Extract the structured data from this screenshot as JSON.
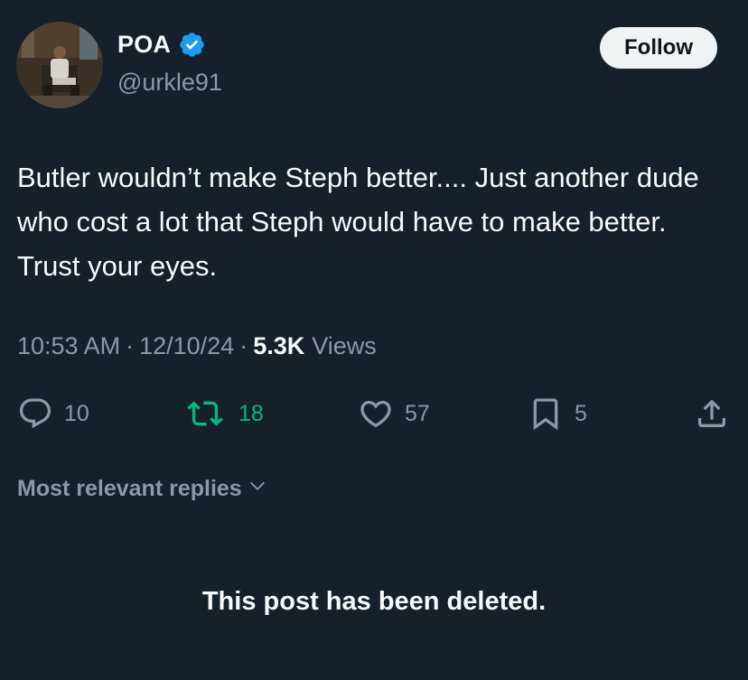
{
  "author": {
    "name": "POA",
    "handle": "@urkle91",
    "verified": true,
    "verified_color": "#1d9bf0"
  },
  "follow_label": "Follow",
  "tweet": {
    "text": "Butler wouldn’t make Steph better.... Just another dude who cost a lot that Steph would have to make better. Trust your eyes.",
    "time": "10:53 AM",
    "date": "12/10/24",
    "views_count": "5.3K",
    "views_label": "Views"
  },
  "actions": {
    "replies": "10",
    "retweets": "18",
    "likes": "57",
    "bookmarks": "5"
  },
  "replies_filter_label": "Most relevant replies",
  "deleted_message": "This post has been deleted.",
  "colors": {
    "background": "#15202b",
    "muted": "#8b98a5",
    "retweet": "#00ba7c"
  },
  "icons": [
    "avatar",
    "verified-badge-icon",
    "reply-icon",
    "retweet-icon",
    "like-icon",
    "bookmark-icon",
    "share-icon",
    "chevron-down-icon"
  ]
}
